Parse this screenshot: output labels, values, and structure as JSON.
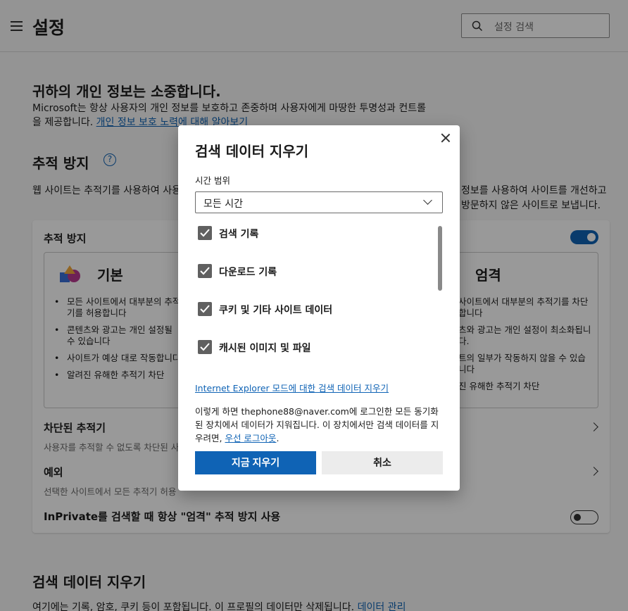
{
  "header": {
    "title": "설정",
    "search_placeholder": "설정 검색"
  },
  "privacy": {
    "heading": "귀하의 개인 정보는 소중합니다.",
    "desc": "Microsoft는 항상 사용자의 개인 정보를 보호하고 존중하며 사용자에게 마땅한 투명성과 컨트롤을 제공합니다. ",
    "link": "개인 정보 보호 노력에 대해 알아보기"
  },
  "tracking": {
    "heading": "추적 방지",
    "help": "?",
    "desc_left": "웹 사이트는 추적기를 사용하여 사용자의 정보를 수집합니다. 하고 개인 설정된 광고와 같은 콘텐츠를 표시합니다.",
    "desc_right": "정보를 사용하여 사이트를 개선하고 방문하지 않은 사이트로 보냅니다.",
    "card_title": "추적 방지",
    "basic": {
      "title": "기본",
      "items": [
        "모든 사이트에서 대부분의 추적기를 허용합니다",
        "콘텐츠와 광고는 개인 설정될 수 있습니다",
        "사이트가 예상 대로 작동합니다",
        "알려진 유해한 추적기 차단"
      ]
    },
    "strict": {
      "title": "엄격",
      "items": [
        "사이트에서 대부분의 추적기를 차단합니다",
        "츠와 광고는 개인 설정이 최소화됩니다.",
        "트의 일부가 작동하지 않을 수 있습니다",
        "진 유해한 추적기 차단"
      ]
    },
    "blocked_title": "차단된 추적기",
    "blocked_sub": "사용자를 추적할 수 없도록 차단된 사이트 보기",
    "exceptions_title": "예외",
    "exceptions_sub": "선택한 사이트에서 모든 추적기 허용",
    "inprivate_label": "InPrivate를 검색할 때 항상 \"엄격\" 추적 방지 사용"
  },
  "clear_section": {
    "heading": "검색 데이터 지우기",
    "desc": "여기에는 기록, 암호, 쿠키 등이 포함됩니다. 이 프로필의 데이터만 삭제됩니다. ",
    "link": "데이터 관리"
  },
  "dialog": {
    "title": "검색 데이터 지우기",
    "time_range_label": "시간 범위",
    "time_range_value": "모든 시간",
    "items": [
      {
        "label": "검색 기록",
        "checked": true
      },
      {
        "label": "다운로드 기록",
        "checked": true
      },
      {
        "label": "쿠키 및 기타 사이트 데이터",
        "checked": true
      },
      {
        "label": "캐시된 이미지 및 파일",
        "checked": true
      }
    ],
    "ie_link": "Internet Explorer 모드에 대한 검색 데이터 지우기",
    "sync_note": "이렇게 하면 thephone88@naver.com에 로그인한 모든 동기화된 장치에서 데이터가 지워집니다. 이 장치에서만 검색 데이터를 지우려면, ",
    "signout_link": "우선 로그아웃",
    "period": ".",
    "clear_button": "지금 지우기",
    "cancel_button": "취소"
  }
}
